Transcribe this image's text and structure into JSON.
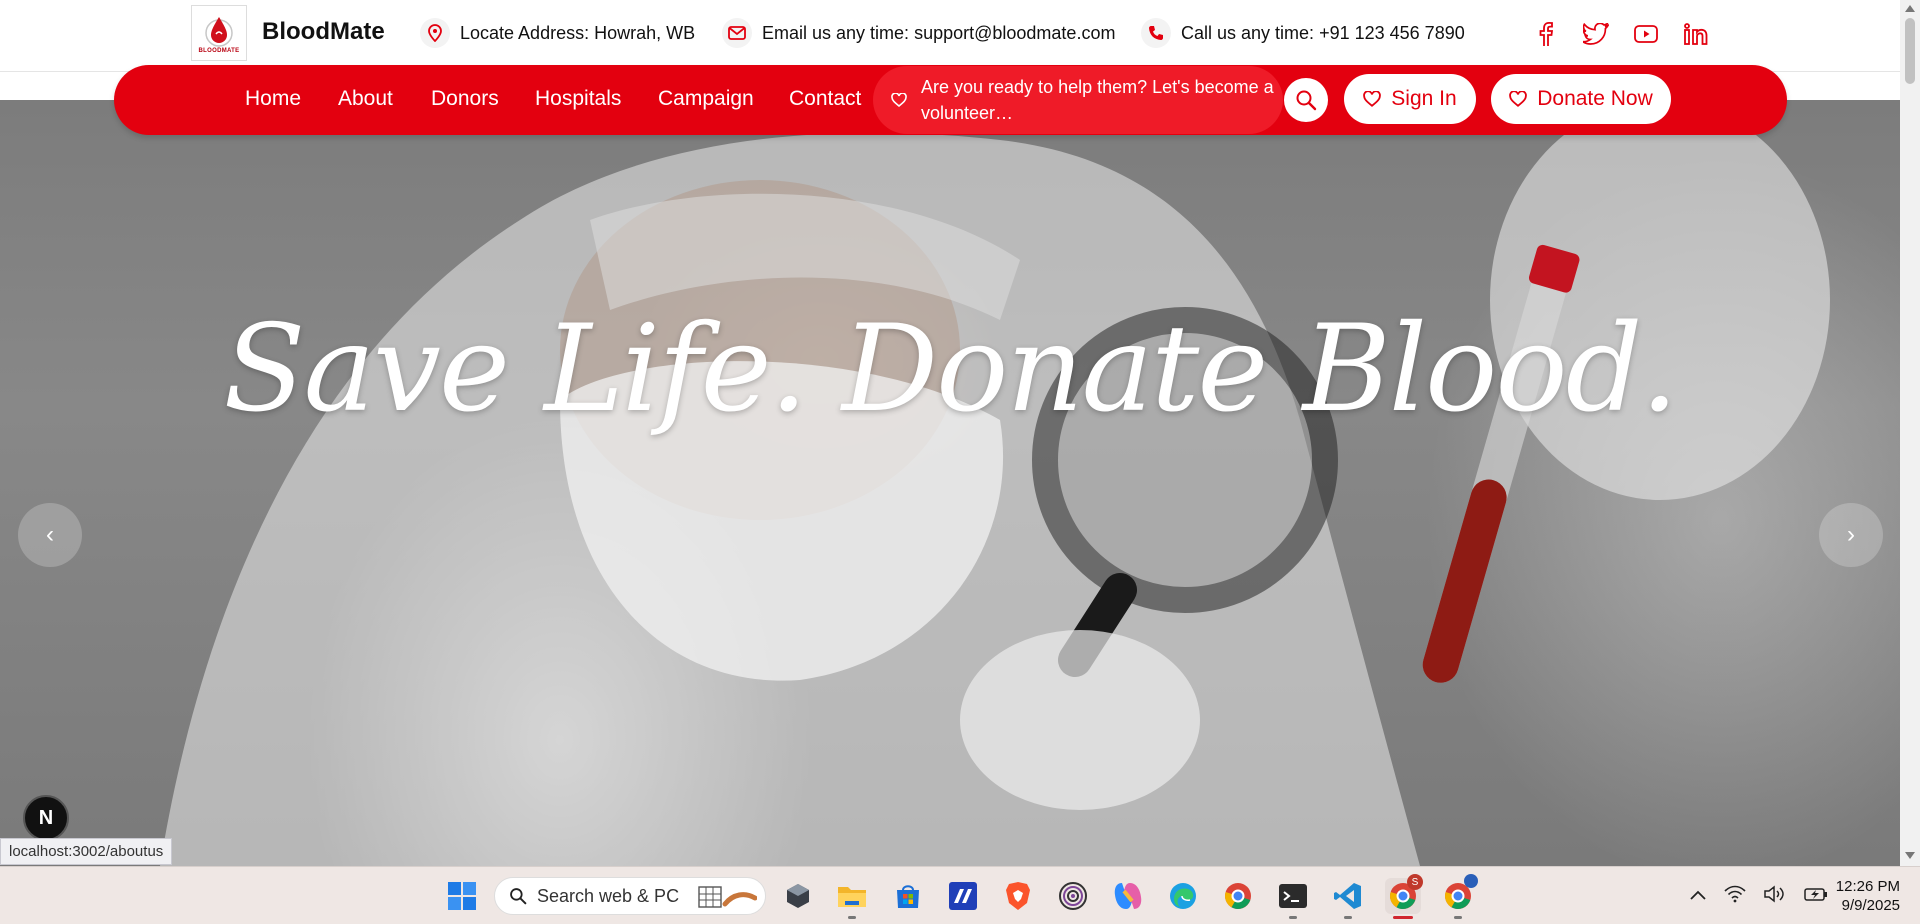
{
  "header": {
    "brand": "BloodMate",
    "logo_text": "BLOODMATE",
    "address_label": "Locate Address:",
    "address_value": "Howrah, WB",
    "email_label": "Email us any time:",
    "email_value": "support@bloodmate.com",
    "phone_label": "Call us any time:",
    "phone_value": "+91 123 456 7890",
    "socials": [
      "facebook-icon",
      "twitter-icon",
      "youtube-icon",
      "linkedin-icon"
    ]
  },
  "nav": {
    "links": [
      "Home",
      "About",
      "Donors",
      "Hospitals",
      "Campaign",
      "Contact"
    ],
    "volunteer_text": "Are you ready to help them? Let's become a volunteer…",
    "signin_label": "Sign In",
    "donate_label": "Donate Now"
  },
  "hero": {
    "title": "Save Life. Donate Blood.",
    "prev_label": "‹",
    "next_label": "›"
  },
  "overlay": {
    "dev_badge": "N",
    "status_url": "localhost:3002/aboutus"
  },
  "taskbar": {
    "search_placeholder": "Search web & PC",
    "time": "12:26 PM",
    "date": "9/9/2025",
    "chrome_badge": "S"
  },
  "colors": {
    "brand_red": "#e3000f",
    "volunteer_red": "#ef1b28"
  }
}
